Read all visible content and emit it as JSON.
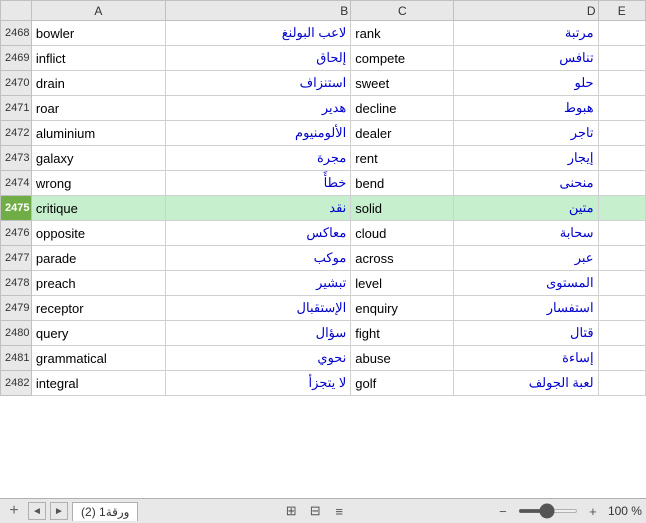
{
  "columns": [
    "",
    "A",
    "B",
    "C",
    "D",
    "E"
  ],
  "rows": [
    {
      "num": "2468",
      "col_a": "bowler",
      "col_b": "لاعب البولنغ",
      "col_c": "rank",
      "col_d": "مرتبة",
      "highlight": false
    },
    {
      "num": "2469",
      "col_a": "inflict",
      "col_b": "إلحاق",
      "col_c": "compete",
      "col_d": "تنافس",
      "highlight": false
    },
    {
      "num": "2470",
      "col_a": "drain",
      "col_b": "استنزاف",
      "col_c": "sweet",
      "col_d": "حلو",
      "highlight": false
    },
    {
      "num": "2471",
      "col_a": "roar",
      "col_b": "هدير",
      "col_c": "decline",
      "col_d": "هبوط",
      "highlight": false
    },
    {
      "num": "2472",
      "col_a": "aluminium",
      "col_b": "الألومنيوم",
      "col_c": "dealer",
      "col_d": "تاجر",
      "highlight": false
    },
    {
      "num": "2473",
      "col_a": "galaxy",
      "col_b": "مجرة",
      "col_c": "rent",
      "col_d": "إيجار",
      "highlight": false
    },
    {
      "num": "2474",
      "col_a": "wrong",
      "col_b": "خطأً",
      "col_c": "bend",
      "col_d": "منحنى",
      "highlight": false
    },
    {
      "num": "2475",
      "col_a": "critique",
      "col_b": "نقد",
      "col_c": "solid",
      "col_d": "متين",
      "highlight": true
    },
    {
      "num": "2476",
      "col_a": "opposite",
      "col_b": "معاكس",
      "col_c": "cloud",
      "col_d": "سحابة",
      "highlight": false
    },
    {
      "num": "2477",
      "col_a": "parade",
      "col_b": "موكب",
      "col_c": "across",
      "col_d": "عبر",
      "highlight": false
    },
    {
      "num": "2478",
      "col_a": "preach",
      "col_b": "تبشير",
      "col_c": "level",
      "col_d": "المستوى",
      "highlight": false
    },
    {
      "num": "2479",
      "col_a": "receptor",
      "col_b": "الإستقبال",
      "col_c": "enquiry",
      "col_d": "استفسار",
      "highlight": false
    },
    {
      "num": "2480",
      "col_a": "query",
      "col_b": "سؤال",
      "col_c": "fight",
      "col_d": "قتال",
      "highlight": false
    },
    {
      "num": "2481",
      "col_a": "grammatical",
      "col_b": "نحوي",
      "col_c": "abuse",
      "col_d": "إساءة",
      "highlight": false
    },
    {
      "num": "2482",
      "col_a": "integral",
      "col_b": "لا يتجزأ",
      "col_c": "golf",
      "col_d": "لعبة الجولف",
      "highlight": false
    }
  ],
  "sheet_tab": "ورقة1 (2)",
  "zoom_label": "100 %",
  "icons": {
    "grid": "⊞",
    "table": "⊟",
    "chart": "≡",
    "plus": "+",
    "left_arrow": "◄",
    "right_arrow": "►",
    "minus": "−",
    "plus_zoom": "+"
  }
}
